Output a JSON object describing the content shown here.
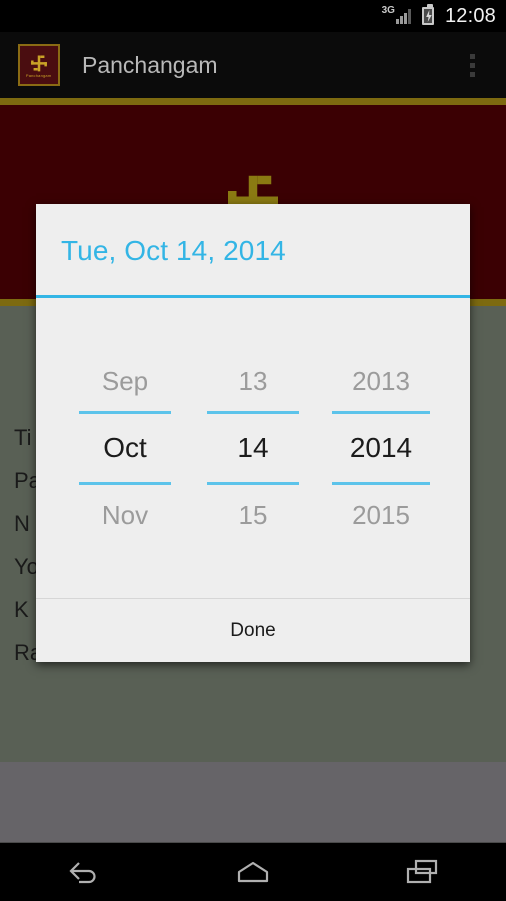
{
  "status_bar": {
    "network_label": "3G",
    "network_icon": "signal-bars-icon",
    "battery_icon": "battery-charging-icon",
    "clock": "12:08"
  },
  "action_bar": {
    "app_icon": "swastika-app-icon",
    "app_icon_caption": "Panchangam",
    "title": "Panchangam",
    "overflow_icon": "overflow-menu-icon"
  },
  "page": {
    "banner_icon": "swastika-icon",
    "detail_rows": [
      {
        "text": "Ti"
      },
      {
        "text": "Pa"
      },
      {
        "text": "N"
      },
      {
        "text": "Yo"
      },
      {
        "text": "K"
      },
      {
        "text": "Ra"
      }
    ]
  },
  "dialog": {
    "header_date": "Tue, Oct 14, 2014",
    "accent_color": "#33b5e5",
    "spinners": [
      {
        "name": "month",
        "prev": "Sep",
        "current": "Oct",
        "next": "Nov"
      },
      {
        "name": "day",
        "prev": "13",
        "current": "14",
        "next": "15"
      },
      {
        "name": "year",
        "prev": "2013",
        "current": "2014",
        "next": "2015"
      }
    ],
    "done_label": "Done"
  },
  "nav_bar": {
    "back_icon": "back-arrow-icon",
    "home_icon": "home-icon",
    "recents_icon": "recent-apps-icon"
  }
}
